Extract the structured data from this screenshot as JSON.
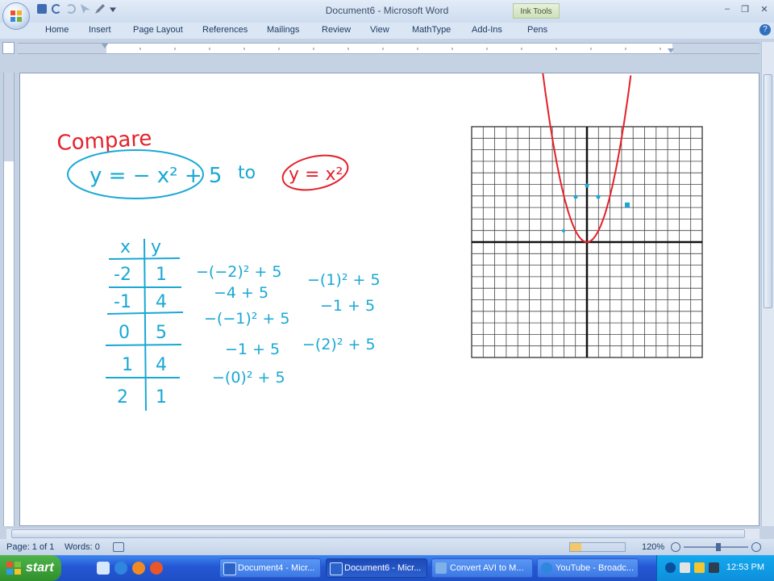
{
  "window": {
    "title": "Document6 - Microsoft Word",
    "contextual_tab": "Ink Tools",
    "minimize": "–",
    "restore": "❐",
    "close": "✕"
  },
  "ribbon": {
    "tabs": [
      "Home",
      "Insert",
      "Page Layout",
      "References",
      "Mailings",
      "Review",
      "View",
      "MathType",
      "Add-Ins",
      "Pens"
    ],
    "help": "?"
  },
  "ink": {
    "compare_word": "Compare",
    "eq1": "y = − x² + 5",
    "to_word": "to",
    "eq2": "y = x²",
    "table_headers": [
      "x",
      "y"
    ],
    "table_rows": [
      [
        "-2",
        "1"
      ],
      [
        "-1",
        "4"
      ],
      [
        "0",
        "5"
      ],
      [
        "1",
        "4"
      ],
      [
        "2",
        "1"
      ]
    ],
    "work_col1": [
      "−(−2)² + 5",
      "−4 + 5",
      "−(−1)² + 5",
      "−1 + 5",
      "−(0)² + 5"
    ],
    "work_col2": [
      "−(1)² + 5",
      "−1 + 5",
      "−(2)² + 5"
    ],
    "colors": {
      "blue": "#19a8d4",
      "red": "#e4202a"
    }
  },
  "graph": {
    "xlim": [
      -10,
      10
    ],
    "ylim": [
      -10,
      10
    ],
    "curve": "y = x²"
  },
  "status": {
    "page": "Page: 1 of 1",
    "words": "Words: 0",
    "zoom": "120%"
  },
  "taskbar": {
    "start": "start",
    "buttons": [
      "Document4 - Micr...",
      "Document6 - Micr...",
      "Convert AVI to M...",
      "YouTube - Broadc..."
    ],
    "active_index": 1,
    "clock": "12:53 PM"
  }
}
